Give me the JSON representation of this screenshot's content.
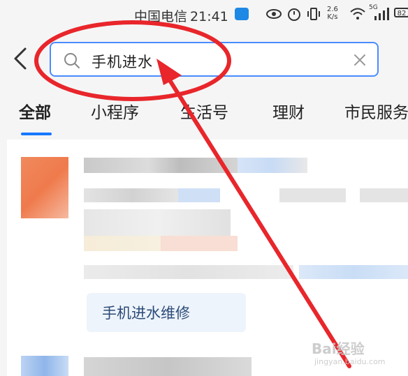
{
  "status_bar": {
    "carrier": "中国电信",
    "time": "21:41",
    "speed_top": "2.6",
    "speed_bottom": "K/s",
    "signal_label": "5G",
    "battery": "82"
  },
  "search": {
    "query": "手机进水"
  },
  "tabs": [
    {
      "label": "全部"
    },
    {
      "label": "小程序"
    },
    {
      "label": "生活号"
    },
    {
      "label": "理财"
    },
    {
      "label": "市民服务"
    }
  ],
  "suggestion": {
    "label": "手机进水维修"
  },
  "watermark": {
    "text": "Bai经验",
    "sub": "jingyan.baidu.com"
  },
  "colors": {
    "accent": "#1677ff",
    "annotation": "#e8262b"
  }
}
